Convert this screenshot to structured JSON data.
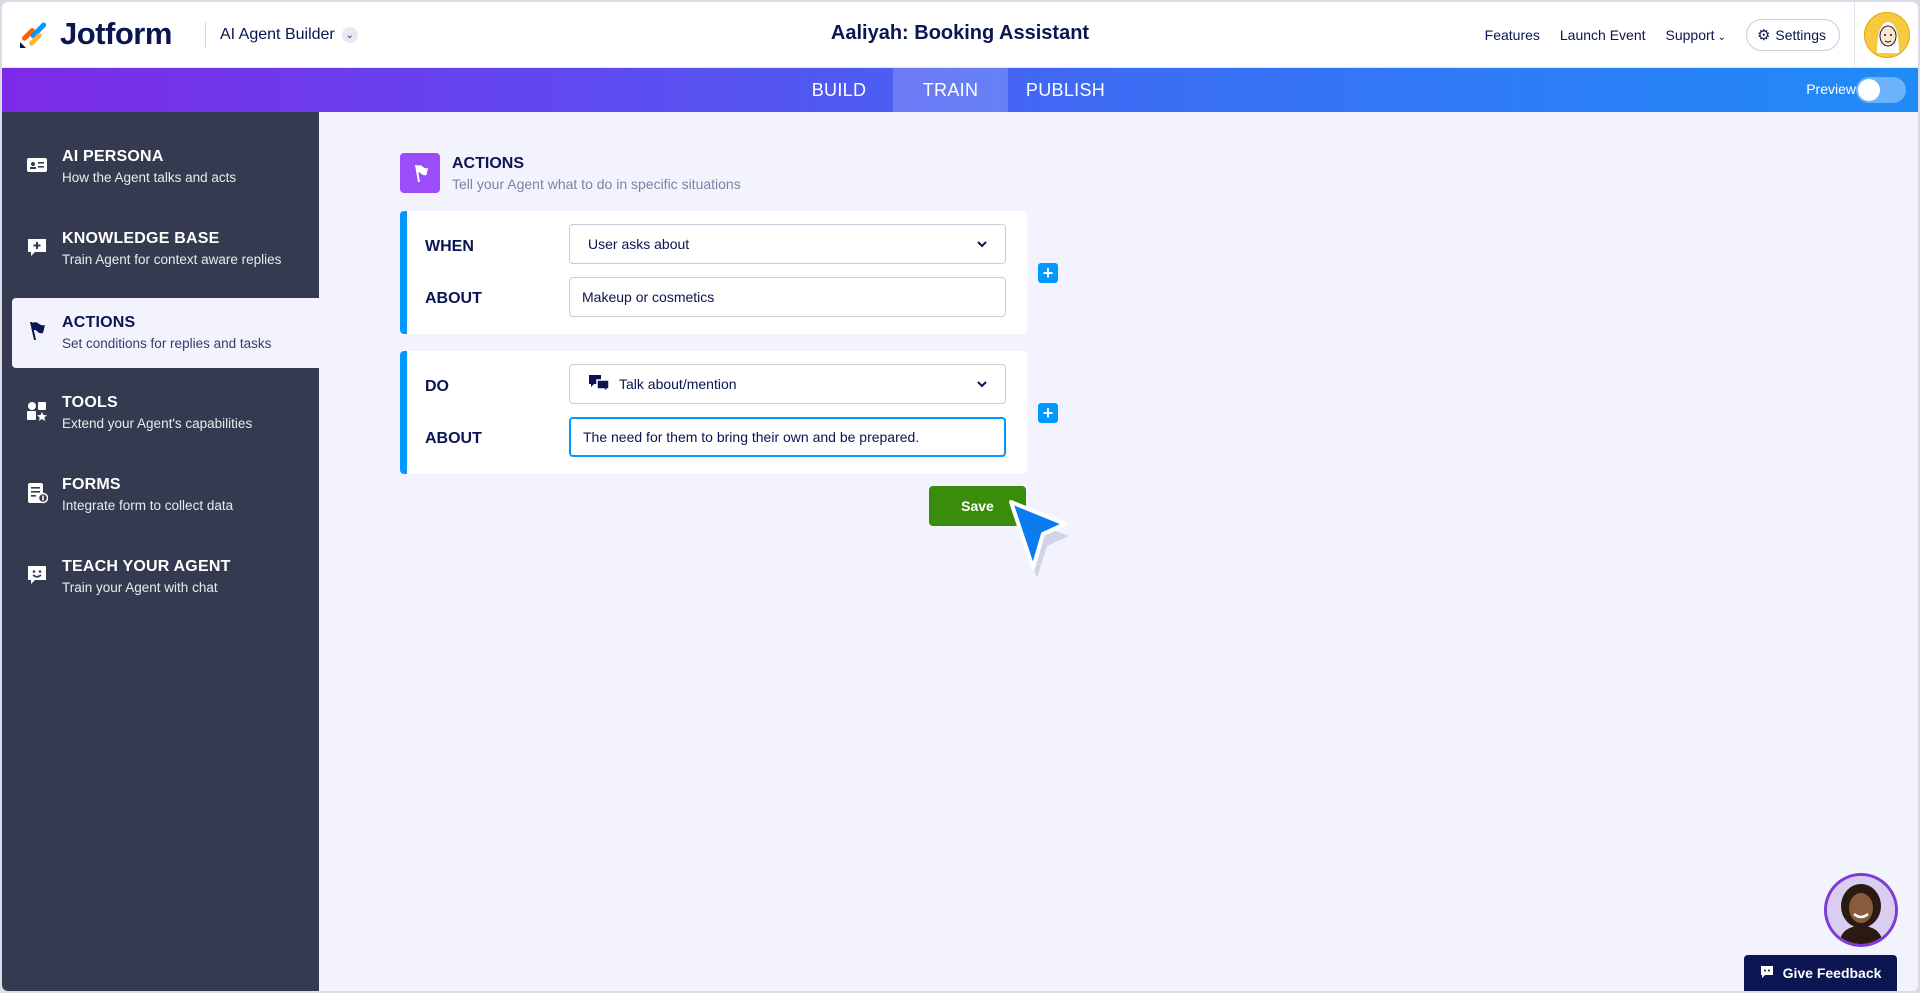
{
  "header": {
    "logo_text": "Jotform",
    "builder_label": "AI Agent Builder",
    "title": "Aaliyah: Booking Assistant",
    "nav": [
      "Features",
      "Launch Event",
      "Support"
    ],
    "settings_label": "Settings"
  },
  "tabs": {
    "items": [
      {
        "label": "BUILD",
        "active": false
      },
      {
        "label": "TRAIN",
        "active": true
      },
      {
        "label": "PUBLISH",
        "active": false
      }
    ],
    "preview_label": "Preview",
    "preview_on": false
  },
  "sidebar": {
    "items": [
      {
        "title": "AI PERSONA",
        "subtitle": "How the Agent talks and acts",
        "icon": "id-card-icon",
        "active": false
      },
      {
        "title": "KNOWLEDGE BASE",
        "subtitle": "Train Agent for context aware replies",
        "icon": "chat-plus-icon",
        "active": false
      },
      {
        "title": "ACTIONS",
        "subtitle": "Set conditions for replies and tasks",
        "icon": "flag-icon",
        "active": true
      },
      {
        "title": "TOOLS",
        "subtitle": "Extend your Agent's capabilities",
        "icon": "shapes-icon",
        "active": false
      },
      {
        "title": "FORMS",
        "subtitle": "Integrate form to collect data",
        "icon": "form-icon",
        "active": false
      },
      {
        "title": "TEACH YOUR AGENT",
        "subtitle": "Train your Agent with chat",
        "icon": "smile-chat-icon",
        "active": false
      }
    ]
  },
  "main": {
    "section_title": "ACTIONS",
    "section_subtitle": "Tell your Agent what to do in specific situations",
    "condition": {
      "when_label": "WHEN",
      "when_value": "User asks about",
      "about_label": "ABOUT",
      "about_value": "Makeup or cosmetics"
    },
    "action": {
      "do_label": "DO",
      "do_value": "Talk about/mention",
      "about_label": "ABOUT",
      "about_value": "The need for them to bring their own and be prepared."
    },
    "save_label": "Save"
  },
  "feedback_label": "Give Feedback",
  "colors": {
    "accent": "#0099ff",
    "save": "#3a8c0c",
    "sidebar": "#343a4f",
    "navy": "#0a1551",
    "purple": "#9c4dfa"
  }
}
